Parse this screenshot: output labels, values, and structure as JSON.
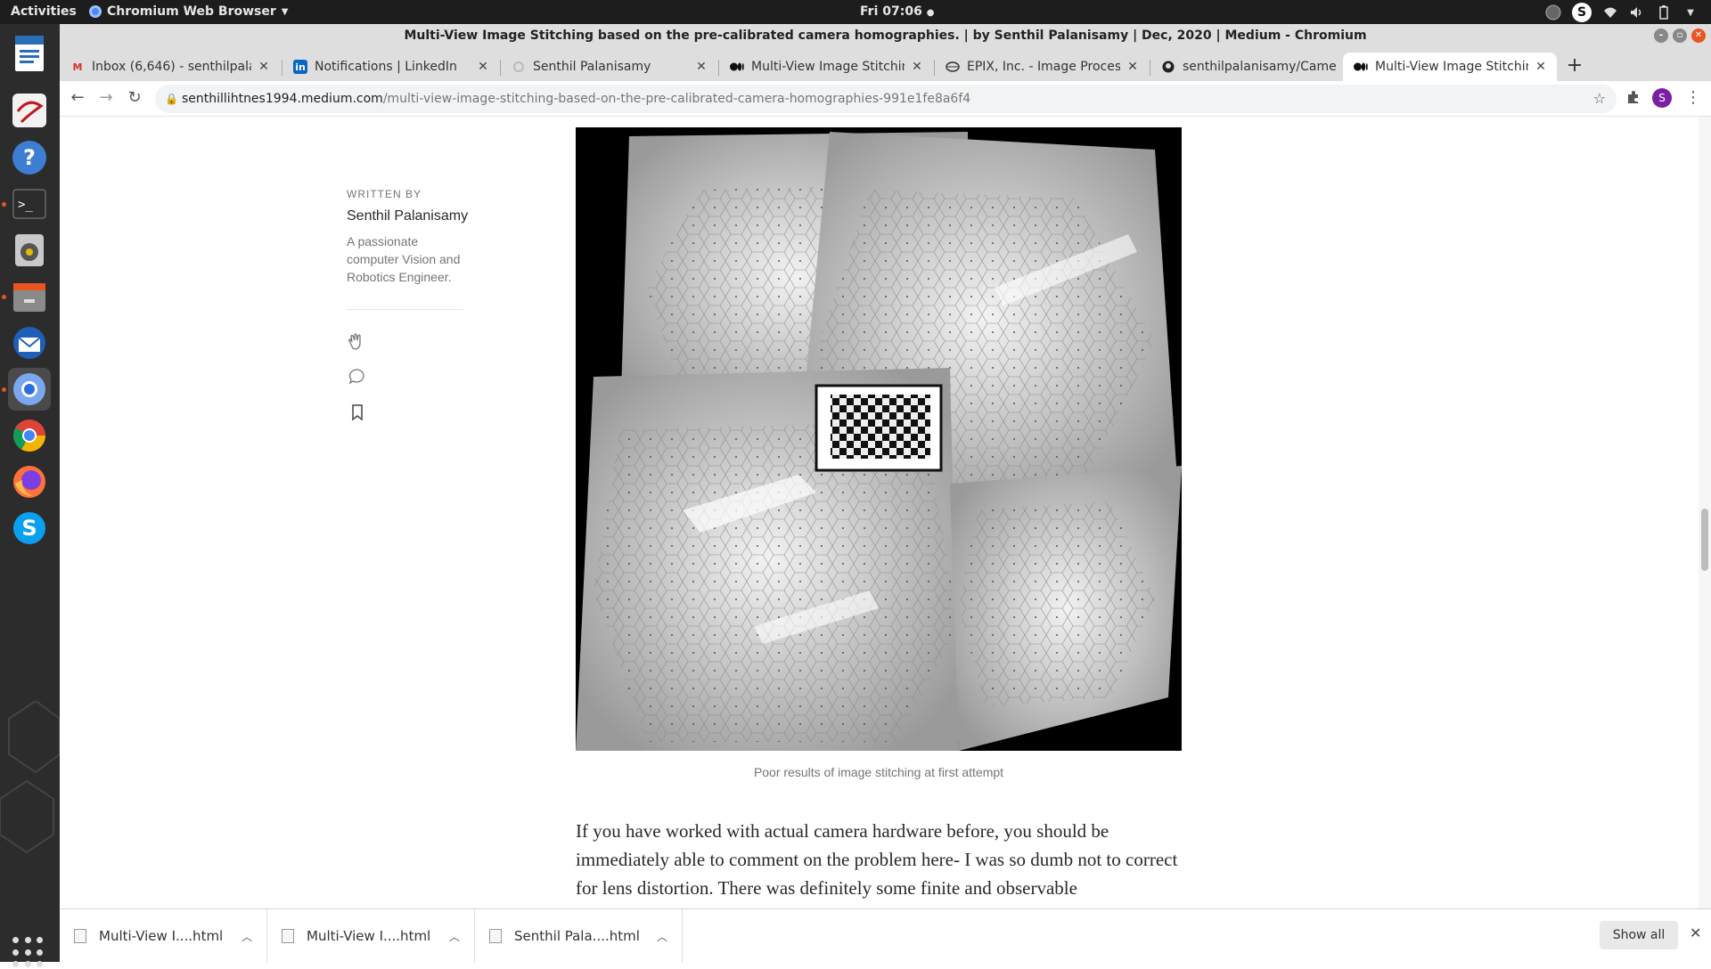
{
  "topbar": {
    "activities": "Activities",
    "app_menu": "Chromium Web Browser",
    "clock": "Fri 07:06"
  },
  "window": {
    "title": "Multi-View Image Stitching based on the pre-calibrated camera homographies. | by Senthil Palanisamy | Dec, 2020 | Medium - Chromium"
  },
  "tabs": [
    {
      "label": "Inbox (6,646) - senthilpala",
      "icon": "gmail-icon"
    },
    {
      "label": "Notifications | LinkedIn",
      "icon": "linkedin-icon"
    },
    {
      "label": "Senthil Palanisamy",
      "icon": "loading-icon"
    },
    {
      "label": "Multi-View Image Stitchin",
      "icon": "medium-icon"
    },
    {
      "label": "EPIX, Inc. - Image Processi",
      "icon": "epix-icon"
    },
    {
      "label": "senthilpalanisamy/Camer",
      "icon": "github-icon"
    },
    {
      "label": "Multi-View Image Stitchin",
      "icon": "medium-icon",
      "active": true
    }
  ],
  "address_bar": {
    "domain": "senthillihtnes1994.medium.com",
    "path": "/multi-view-image-stitching-based-on-the-pre-calibrated-camera-homographies-991e1fe8a6f4"
  },
  "profile_initial": "S",
  "sidebar": {
    "written_by": "WRITTEN BY",
    "author": "Senthil Palanisamy",
    "bio": "A passionate computer Vision and Robotics Engineer."
  },
  "article": {
    "caption": "Poor results of image stitching at first attempt",
    "body": "If you have worked with actual camera hardware before, you should be immediately able to comment on the problem here- I was so dumb not to correct for lens distortion. There was definitely some finite and observable"
  },
  "downloads": {
    "items": [
      "Multi-View I....html",
      "Multi-View I....html",
      "Senthil Pala....html"
    ],
    "show_all": "Show all"
  }
}
